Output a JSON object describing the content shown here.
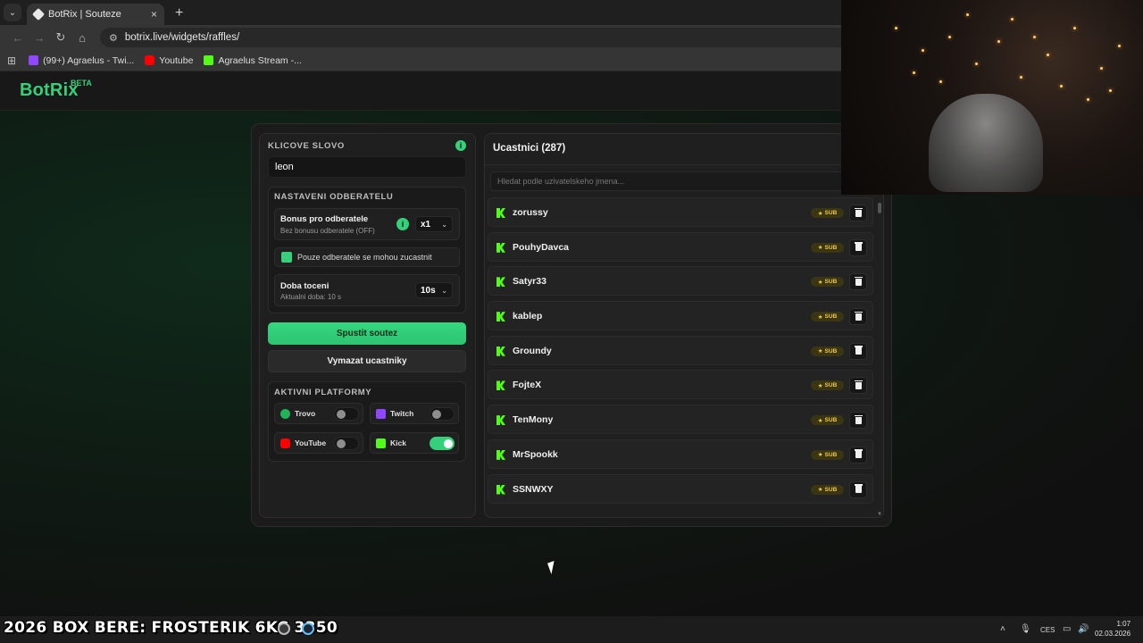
{
  "browser": {
    "tab_title": "BotRix | Souteze",
    "close_glyph": "×",
    "new_tab_glyph": "+",
    "tab_menu_glyph": "⌄",
    "url": "botrix.live/widgets/raffles/",
    "bookmarks": [
      {
        "label": "(99+) Agraelus - Twi...",
        "icon": "twitch-icon"
      },
      {
        "label": "Youtube",
        "icon": "youtube-icon"
      },
      {
        "label": "Agraelus Stream -...",
        "icon": "kick-icon"
      }
    ]
  },
  "site": {
    "logo": "BotRix",
    "beta": "BETA"
  },
  "keyword": {
    "title": "KLICOVE SLOVO",
    "value": "leon",
    "info_glyph": "i"
  },
  "subscriber_settings": {
    "title": "NASTAVENI ODBERATELU",
    "bonus_label": "Bonus pro odberatele",
    "bonus_sub": "Bez bonusu odberatele (OFF)",
    "bonus_value": "x1",
    "only_subs_label": "Pouze odberatele se mohou zucastnit",
    "only_subs_checked": true,
    "spin_label": "Doba toceni",
    "spin_sub": "Aktualni doba: 10 s",
    "spin_value": "10s"
  },
  "buttons": {
    "start": "Spustit soutez",
    "clear": "Vymazat ucastniky"
  },
  "platforms": {
    "title": "AKTIVNI PLATFORMY",
    "items": [
      {
        "name": "Trovo",
        "enabled": false
      },
      {
        "name": "Twitch",
        "enabled": false
      },
      {
        "name": "YouTube",
        "enabled": false
      },
      {
        "name": "Kick",
        "enabled": true
      }
    ]
  },
  "participants": {
    "title": "Ucastnici (287)",
    "search_placeholder": "Hledat podle uzivatelskeho jmena...",
    "badge": "SUB",
    "list": [
      "zorussy",
      "PouhyDavca",
      "Satyr33",
      "kablep",
      "Groundy",
      "FojteX",
      "TenMony",
      "MrSpookk",
      "SSNWXY"
    ]
  },
  "taskbar": {
    "overlay": "2026 BOX BERE: FROSTERIK 6KC 3350",
    "lang": "CES",
    "time": "1:07",
    "date": "02.03.2026"
  },
  "colors": {
    "accent": "#34d17a",
    "kick": "#53fc18",
    "badge_text": "#f1c93b"
  }
}
